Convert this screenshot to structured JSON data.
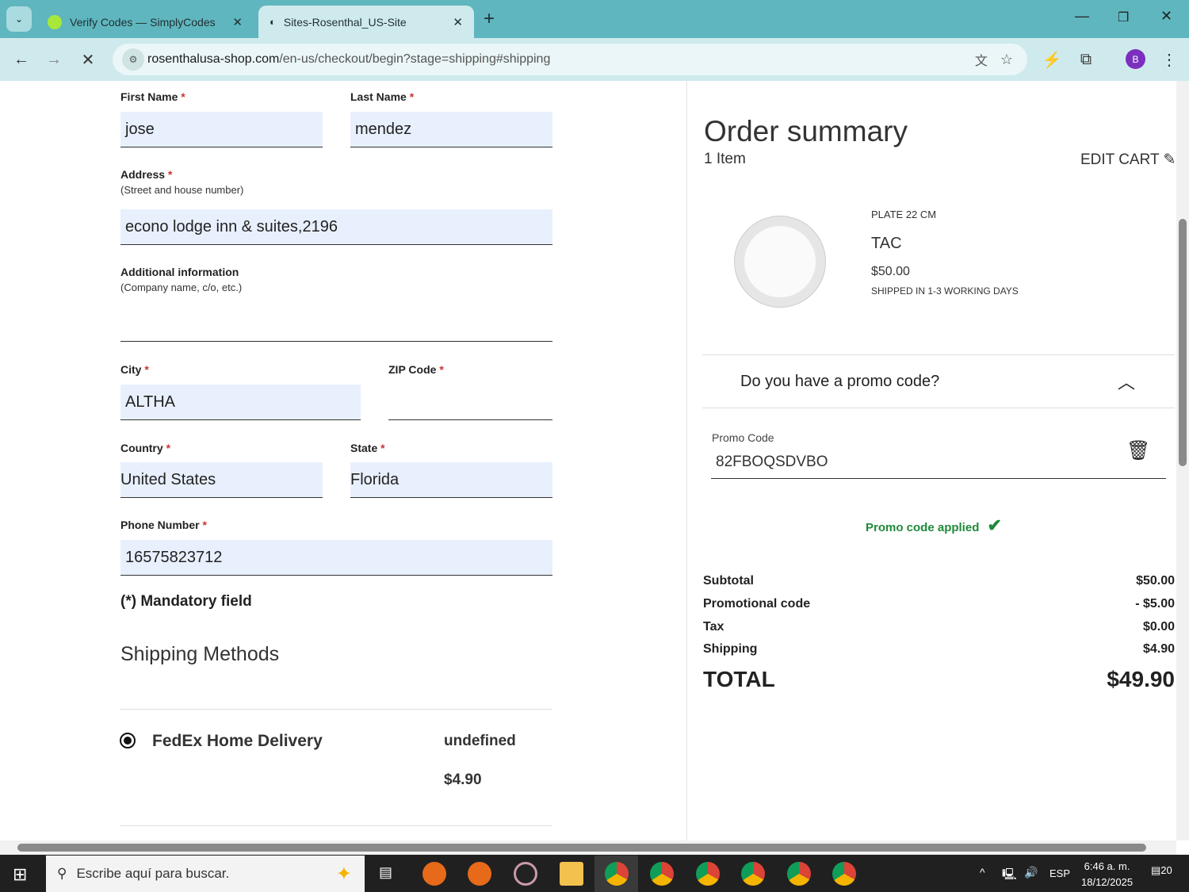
{
  "browser": {
    "tabs": [
      {
        "title": "Verify Codes — SimplyCodes",
        "active": false
      },
      {
        "title": "Sites-Rosenthal_US-Site",
        "active": true
      }
    ],
    "url_host": "rosenthalusa-shop.com",
    "url_path": "/en-us/checkout/begin?stage=shipping#shipping",
    "profile_initial": "B"
  },
  "form": {
    "first_name": {
      "label": "First Name",
      "value": "jose"
    },
    "last_name": {
      "label": "Last Name",
      "value": "mendez"
    },
    "address": {
      "label": "Address",
      "hint": "(Street and house number)",
      "value": "econo lodge inn & suites,2196"
    },
    "additional": {
      "label": "Additional information",
      "hint": "(Company name, c/o, etc.)",
      "value": ""
    },
    "city": {
      "label": "City",
      "value": "ALTHA"
    },
    "zip": {
      "label": "ZIP Code",
      "value": ""
    },
    "country": {
      "label": "Country",
      "value": "United States"
    },
    "state": {
      "label": "State",
      "value": "Florida"
    },
    "phone": {
      "label": "Phone Number",
      "value": "16575823712"
    },
    "required_marker": "*",
    "mandatory_note": "(*) Mandatory field",
    "shipping_title": "Shipping Methods",
    "shipping_method": {
      "name": "FedEx Home Delivery",
      "eta": "undefined",
      "price": "$4.90",
      "selected": true
    }
  },
  "summary": {
    "title": "Order summary",
    "item_count": "1 Item",
    "edit_cart": "EDIT CART",
    "product": {
      "category": "PLATE 22 CM",
      "name": "TAC",
      "price": "$50.00",
      "shipping_note": "SHIPPED IN 1-3 WORKING DAYS"
    },
    "promo_question": "Do you have a promo code?",
    "promo_label": "Promo Code",
    "promo_value": "82FBOQSDVBO",
    "promo_status": "Promo code applied",
    "rows": [
      {
        "label": "Subtotal",
        "value": "$50.00"
      },
      {
        "label": "Promotional code",
        "value": "- $5.00"
      },
      {
        "label": "Tax",
        "value": "$0.00"
      },
      {
        "label": "Shipping",
        "value": "$4.90"
      }
    ],
    "total_label": "TOTAL",
    "total_value": "$49.90"
  },
  "taskbar": {
    "search_placeholder": "Escribe aquí para buscar.",
    "lang": "ESP",
    "time": "6:46 a. m.",
    "date": "18/12/2025",
    "notifications": "20"
  },
  "colors": {
    "tabbar": "#5fb6be",
    "toolbar": "#cfeaed",
    "field": "#e8f0fe",
    "success": "#1f8a3a"
  }
}
